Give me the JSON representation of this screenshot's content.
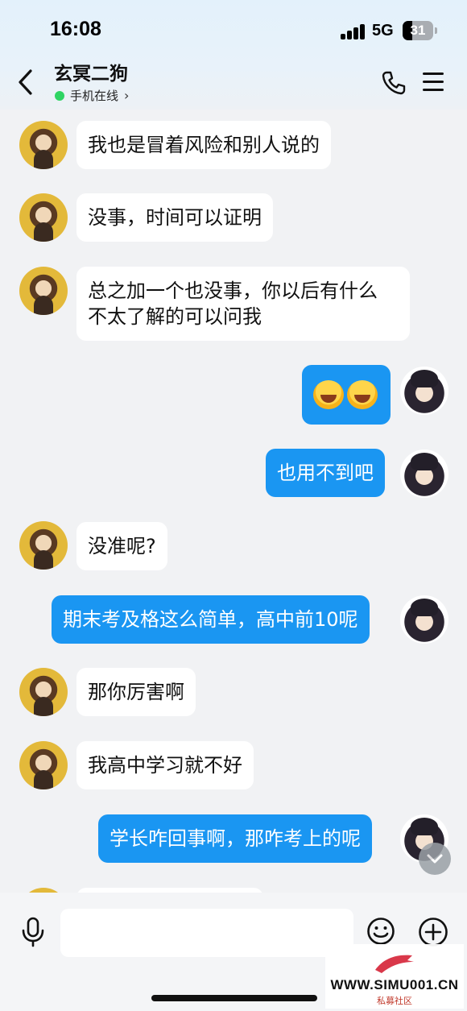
{
  "status_bar": {
    "time": "16:08",
    "network": "5G",
    "battery_level": "31"
  },
  "header": {
    "contact_name": "玄冥二狗",
    "online_status": "手机在线",
    "chevron": "›"
  },
  "messages": [
    {
      "side": "in",
      "text": "我也是冒着风险和别人说的"
    },
    {
      "side": "in",
      "text": "没事，时间可以证明"
    },
    {
      "side": "in",
      "text_line1": "总之加一个也没事，你以后有什么",
      "text_line2": "不太了解的可以问我"
    },
    {
      "side": "out",
      "type": "emoji",
      "emoji_name": "laughing-crying-face-icon"
    },
    {
      "side": "out",
      "text": "也用不到吧"
    },
    {
      "side": "in",
      "text": "没准呢?"
    },
    {
      "side": "out",
      "text": "期末考及格这么简单，高中前10呢"
    },
    {
      "side": "in",
      "text": "那你厉害啊"
    },
    {
      "side": "in",
      "text": "我高中学习就不好"
    },
    {
      "side": "out",
      "text": "学长咋回事啊，那咋考上的呢"
    }
  ],
  "input": {
    "placeholder": ""
  },
  "watermark": {
    "url": "WWW.SIMU001.CN",
    "subtitle": "私募社区"
  },
  "colors": {
    "outgoing_bubble": "#1a96f2",
    "incoming_bubble": "#ffffff",
    "online_dot": "#2fd463",
    "background": "#f1f2f4"
  }
}
